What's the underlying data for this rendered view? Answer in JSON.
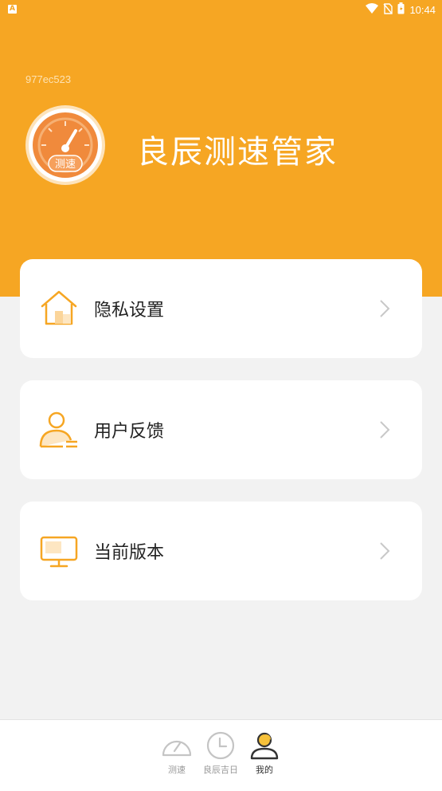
{
  "status_bar": {
    "time": "10:44",
    "left_badge": "A"
  },
  "header": {
    "device_id": "977ec523",
    "app_title": "良辰测速管家",
    "logo_text": "测速"
  },
  "menu": [
    {
      "label": "隐私设置",
      "icon": "home-icon"
    },
    {
      "label": "用户反馈",
      "icon": "user-feedback-icon"
    },
    {
      "label": "当前版本",
      "icon": "monitor-icon"
    }
  ],
  "tabs": [
    {
      "label": "测速",
      "icon": "speedometer-icon",
      "active": false
    },
    {
      "label": "良辰吉日",
      "icon": "clock-icon",
      "active": false
    },
    {
      "label": "我的",
      "icon": "profile-icon",
      "active": true
    }
  ],
  "colors": {
    "accent": "#f6a623",
    "background": "#f2f2f2",
    "card": "#ffffff"
  }
}
